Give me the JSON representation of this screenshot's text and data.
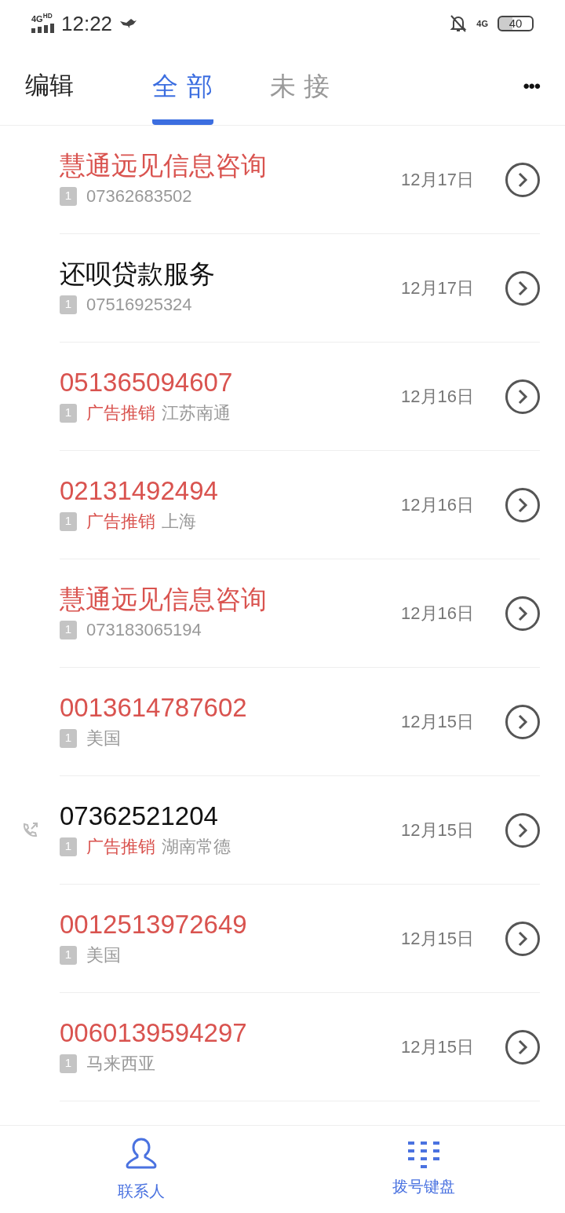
{
  "status_bar": {
    "network": "4G",
    "network_sup": "HD",
    "time": "12:22",
    "data_type": "4G",
    "battery": "40"
  },
  "header": {
    "edit": "编辑",
    "more": "•••",
    "tabs": [
      {
        "label": "全 部",
        "selected": true
      },
      {
        "label": "未 接",
        "selected": false
      }
    ]
  },
  "calls": [
    {
      "name": "慧通远见信息咨询",
      "missed": true,
      "outgoing": false,
      "sim": "1",
      "detail": "07362683502",
      "date": "12月17日"
    },
    {
      "name": "还呗贷款服务",
      "missed": false,
      "outgoing": false,
      "sim": "1",
      "detail": "07516925324",
      "date": "12月17日"
    },
    {
      "name": "051365094607",
      "missed": true,
      "outgoing": false,
      "sim": "1",
      "tag": "广告推销",
      "detail": "江苏南通",
      "date": "12月16日"
    },
    {
      "name": "02131492494",
      "missed": true,
      "outgoing": false,
      "sim": "1",
      "tag": "广告推销",
      "detail": "上海",
      "date": "12月16日"
    },
    {
      "name": "慧通远见信息咨询",
      "missed": true,
      "outgoing": false,
      "sim": "1",
      "detail": "073183065194",
      "date": "12月16日"
    },
    {
      "name": "0013614787602",
      "missed": true,
      "outgoing": false,
      "sim": "1",
      "detail": "美国",
      "date": "12月15日"
    },
    {
      "name": "07362521204",
      "missed": false,
      "outgoing": true,
      "sim": "1",
      "tag": "广告推销",
      "detail": "湖南常德",
      "date": "12月15日"
    },
    {
      "name": "0012513972649",
      "missed": true,
      "outgoing": false,
      "sim": "1",
      "detail": "美国",
      "date": "12月15日"
    },
    {
      "name": "0060139594297",
      "missed": true,
      "outgoing": false,
      "sim": "1",
      "detail": "马来西亚",
      "date": "12月15日"
    }
  ],
  "bottom_nav": [
    {
      "kind": "contacts",
      "label": "联系人"
    },
    {
      "kind": "dialpad",
      "label": "拨号键盘"
    }
  ]
}
